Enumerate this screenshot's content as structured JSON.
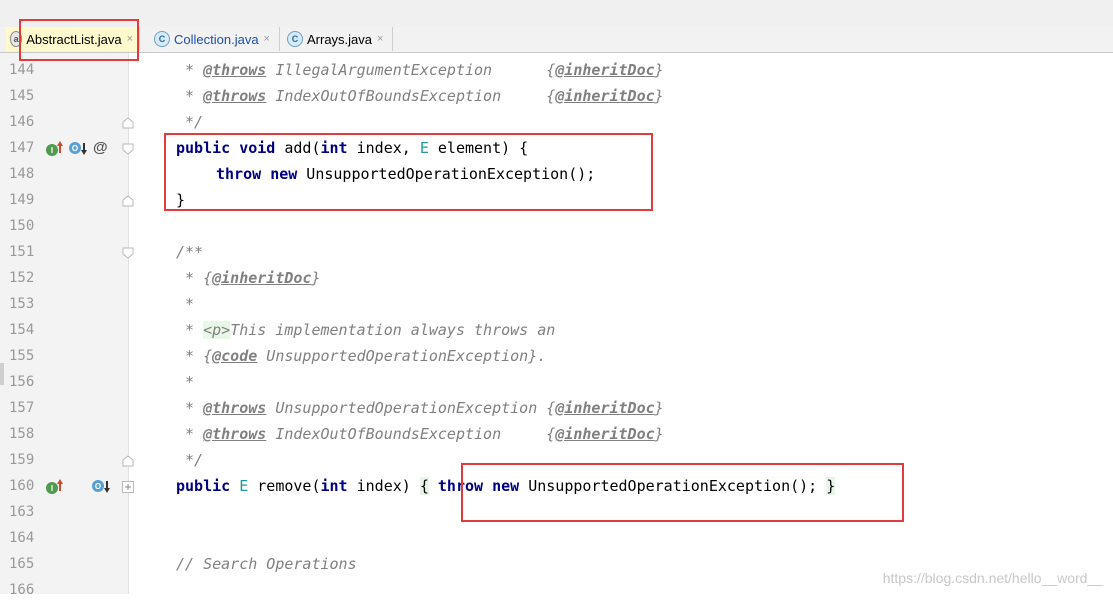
{
  "tabs": [
    {
      "label": "AbstractList.java",
      "icon": "abstract-class-icon",
      "active": true
    },
    {
      "label": "Collection.java",
      "icon": "interface-icon",
      "active": false
    },
    {
      "label": "Arrays.java",
      "icon": "class-icon",
      "active": false
    }
  ],
  "tab_close_glyph": "×",
  "lines": {
    "l144": {
      "num": "144",
      "a": " * ",
      "b": "@throws",
      "c": " IllegalArgumentException      {",
      "d": "@inheritDoc",
      "e": "}"
    },
    "l145": {
      "num": "145",
      "a": " * ",
      "b": "@throws",
      "c": " IndexOutOfBoundsException     {",
      "d": "@inheritDoc",
      "e": "}"
    },
    "l146": {
      "num": "146",
      "a": " */"
    },
    "l147": {
      "num": "147",
      "kw1": "public",
      "kw2": "void",
      "a": " add(",
      "kw3": "int",
      "b": " index, ",
      "tp": "E",
      "c": " element) {"
    },
    "l148": {
      "num": "148",
      "kw1": "throw",
      "kw2": "new",
      "a": " UnsupportedOperationException();"
    },
    "l149": {
      "num": "149",
      "a": "}"
    },
    "l150": {
      "num": "150"
    },
    "l151": {
      "num": "151",
      "a": "/**"
    },
    "l152": {
      "num": "152",
      "a": " * {",
      "b": "@inheritDoc",
      "c": "}"
    },
    "l153": {
      "num": "153",
      "a": " *"
    },
    "l154": {
      "num": "154",
      "a": " * ",
      "ph": "<p>",
      "b": "This implementation always throws an"
    },
    "l155": {
      "num": "155",
      "a": " * {",
      "b": "@code",
      "c": " UnsupportedOperationException}."
    },
    "l156": {
      "num": "156",
      "a": " *"
    },
    "l157": {
      "num": "157",
      "a": " * ",
      "b": "@throws",
      "c": " UnsupportedOperationException {",
      "d": "@inheritDoc",
      "e": "}"
    },
    "l158": {
      "num": "158",
      "a": " * ",
      "b": "@throws",
      "c": " IndexOutOfBoundsException     {",
      "d": "@inheritDoc",
      "e": "}"
    },
    "l159": {
      "num": "159",
      "a": " */"
    },
    "l160": {
      "num": "160",
      "kw1": "public",
      "tp": "E",
      "a": " remove(",
      "kw2": "int",
      "b": " index) ",
      "br1": "{",
      "kw3": "throw",
      "kw4": "new",
      "c": " UnsupportedOperationException(); ",
      "br2": "}"
    },
    "l163": {
      "num": "163"
    },
    "l164": {
      "num": "164"
    },
    "l165": {
      "num": "165",
      "a": "// Search Operations"
    },
    "l166": {
      "num": "166"
    }
  },
  "gutter_icons": {
    "implements": "I",
    "overrides": "O",
    "annotation": "@"
  },
  "watermark": "https://blog.csdn.net/hello__word__",
  "colors": {
    "keyword": "#000080",
    "comment": "#808080",
    "type_param": "#20999d",
    "highlight_box": "#e33b3b"
  }
}
